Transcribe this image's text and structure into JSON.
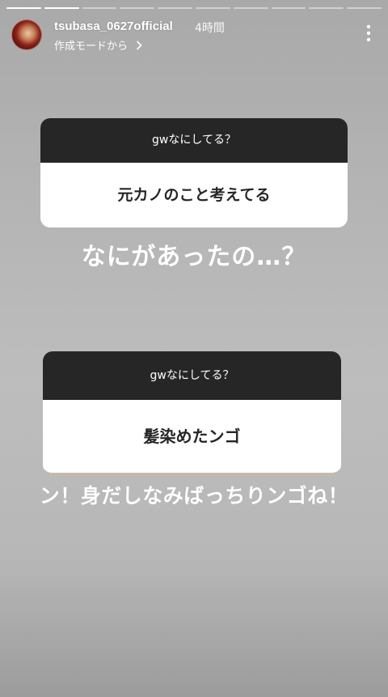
{
  "story": {
    "segments_total": 10,
    "segments_done": 2
  },
  "header": {
    "username": "tsubasa_0627official",
    "time_ago": "4時間",
    "source_label": "作成モードから",
    "avatar_icon": "profile-photo",
    "more_icon": "vertical-ellipsis"
  },
  "question1": {
    "prompt": "gwなにしてる？",
    "answer": "元カノのこと考えてる"
  },
  "caption1": "なにがあったの…？",
  "question2": {
    "prompt": "gwなにしてる？",
    "answer": "髪染めたンゴ"
  },
  "caption2": "ン！身だしなみばっちりンゴね！",
  "colors": {
    "box_header": "#262626",
    "box_body": "#ffffff",
    "caption_text": "#ffffff"
  }
}
